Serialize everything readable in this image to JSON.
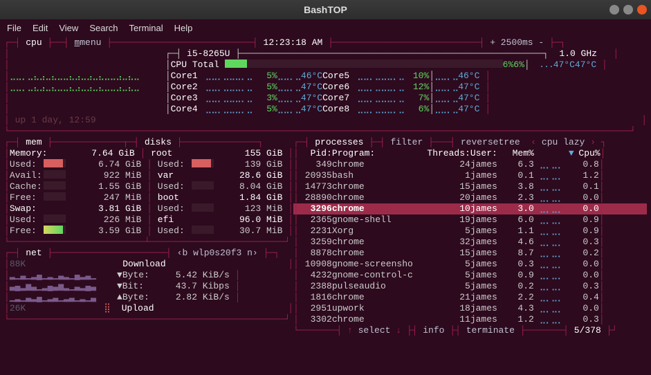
{
  "window": {
    "title": "BashTOP"
  },
  "menubar": [
    "File",
    "Edit",
    "View",
    "Search",
    "Terminal",
    "Help"
  ],
  "top": {
    "cpu_label": "cpu",
    "menu_label": "menu",
    "cpu_model": "i5-8265U",
    "time": "12:23:18 AM",
    "refresh": "2500ms",
    "freq": "1.0 GHz",
    "uptime": "up 1 day, 12:59",
    "total_label": "CPU Total",
    "total_pct": "6%",
    "total_temp": "47°C",
    "cores": [
      {
        "name": "Core1",
        "pct": "5%",
        "temp": "46°C"
      },
      {
        "name": "Core2",
        "pct": "5%",
        "temp": "47°C"
      },
      {
        "name": "Core3",
        "pct": "3%",
        "temp": "47°C"
      },
      {
        "name": "Core4",
        "pct": "5%",
        "temp": "47°C"
      },
      {
        "name": "Core5",
        "pct": "10%",
        "temp": "46°C"
      },
      {
        "name": "Core6",
        "pct": "12%",
        "temp": "47°C"
      },
      {
        "name": "Core7",
        "pct": "7%",
        "temp": "47°C"
      },
      {
        "name": "Core8",
        "pct": "6%",
        "temp": "47°C"
      }
    ]
  },
  "mem": {
    "label": "mem",
    "memory_label": "Memory:",
    "memory_val": "7.64 GiB",
    "used_label": "Used:",
    "used_val": "6.74 GiB",
    "avail_label": "Avail:",
    "avail_val": "922 MiB",
    "cache_label": "Cache:",
    "cache_val": "1.55 GiB",
    "free_label": "Free:",
    "free_val": "247 MiB",
    "swap_label": "Swap:",
    "swap_val": "3.81 GiB",
    "swap_used_label": "Used:",
    "swap_used_val": "226 MiB",
    "swap_free_label": "Free:",
    "swap_free_val": "3.59 GiB"
  },
  "disks": {
    "label": "disks",
    "items": [
      {
        "name": "root",
        "total": "155 GiB",
        "used_label": "Used:",
        "used_val": "139 GiB"
      },
      {
        "name": "var",
        "total": "28.6 GiB",
        "used_label": "Used:",
        "used_val": "8.04 GiB"
      },
      {
        "name": "boot",
        "total": "1.84 GiB",
        "used_label": "Used:",
        "used_val": "123 MiB"
      },
      {
        "name": "efi",
        "total": "96.0 MiB",
        "used_label": "Used:",
        "used_val": "30.7 MiB"
      }
    ]
  },
  "net": {
    "label": "net",
    "iface": "b wlp0s20f3 n",
    "download_label": "Download",
    "upload_label": "Upload",
    "byte_down_label": "Byte:",
    "byte_down_val": "5.42 KiB/s",
    "bit_label": "Bit:",
    "bit_val": "43.7 Kibps",
    "byte_up_label": "Byte:",
    "byte_up_val": "2.82 KiB/s",
    "top_scale": "88K",
    "bot_scale": "26K"
  },
  "proc": {
    "labels": {
      "processes": "processes",
      "filter": "filter",
      "reverse": "reverse",
      "tree": "tree",
      "sort": "cpu lazy"
    },
    "headers": {
      "pid": "Pid:",
      "program": "Program:",
      "threads": "Threads:",
      "user": "User:",
      "mem": "Mem%",
      "cpu": "Cpu%"
    },
    "rows": [
      {
        "pid": "349",
        "prog": "chrome",
        "thr": "24",
        "user": "james",
        "mem": "6.3",
        "cpu": "0.8"
      },
      {
        "pid": "20935",
        "prog": "bash",
        "thr": "1",
        "user": "james",
        "mem": "0.1",
        "cpu": "1.2"
      },
      {
        "pid": "14773",
        "prog": "chrome",
        "thr": "15",
        "user": "james",
        "mem": "3.8",
        "cpu": "0.1"
      },
      {
        "pid": "28890",
        "prog": "chrome",
        "thr": "20",
        "user": "james",
        "mem": "2.3",
        "cpu": "0.0"
      },
      {
        "pid": "3296",
        "prog": "chrome",
        "thr": "10",
        "user": "james",
        "mem": "3.0",
        "cpu": "0.0",
        "selected": true
      },
      {
        "pid": "2365",
        "prog": "gnome-shell",
        "thr": "19",
        "user": "james",
        "mem": "6.0",
        "cpu": "0.9"
      },
      {
        "pid": "2231",
        "prog": "Xorg",
        "thr": "5",
        "user": "james",
        "mem": "1.1",
        "cpu": "0.9"
      },
      {
        "pid": "3259",
        "prog": "chrome",
        "thr": "32",
        "user": "james",
        "mem": "4.6",
        "cpu": "0.3"
      },
      {
        "pid": "8878",
        "prog": "chrome",
        "thr": "15",
        "user": "james",
        "mem": "8.7",
        "cpu": "0.2"
      },
      {
        "pid": "10908",
        "prog": "gnome-screensho",
        "thr": "5",
        "user": "james",
        "mem": "0.3",
        "cpu": "0.0"
      },
      {
        "pid": "4232",
        "prog": "gnome-control-c",
        "thr": "5",
        "user": "james",
        "mem": "0.9",
        "cpu": "0.0"
      },
      {
        "pid": "2388",
        "prog": "pulseaudio",
        "thr": "5",
        "user": "james",
        "mem": "0.2",
        "cpu": "0.3"
      },
      {
        "pid": "1816",
        "prog": "chrome",
        "thr": "21",
        "user": "james",
        "mem": "2.2",
        "cpu": "0.4"
      },
      {
        "pid": "2951",
        "prog": "upwork",
        "thr": "18",
        "user": "james",
        "mem": "4.3",
        "cpu": "0.0"
      },
      {
        "pid": "3302",
        "prog": "chrome",
        "thr": "11",
        "user": "james",
        "mem": "1.2",
        "cpu": "0.3"
      }
    ],
    "footer": {
      "select": "select",
      "info": "info",
      "terminate": "terminate",
      "pos": "5/378"
    }
  }
}
